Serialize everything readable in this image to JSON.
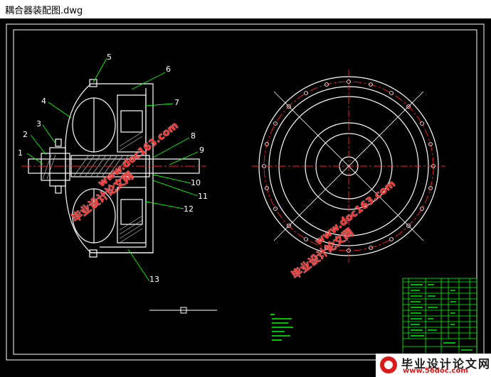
{
  "window": {
    "title": "耦合器装配图.dwg"
  },
  "drawing": {
    "part_labels": [
      "1",
      "2",
      "3",
      "4",
      "5",
      "6",
      "7",
      "8",
      "9",
      "10",
      "11",
      "12",
      "13"
    ],
    "colors": {
      "background": "#000000",
      "outline": "#ffffff",
      "leader": "#00ff00",
      "centerline": "#ff2020",
      "hatch": "#d0d0d0",
      "border": "#ffffff",
      "titleblock": "#00ff00"
    }
  },
  "watermarks": {
    "cn": "毕业设计论文网",
    "url": "www.doc163.com"
  },
  "brand": {
    "name": "毕业设计论文网",
    "url": "www.56doc.com"
  }
}
